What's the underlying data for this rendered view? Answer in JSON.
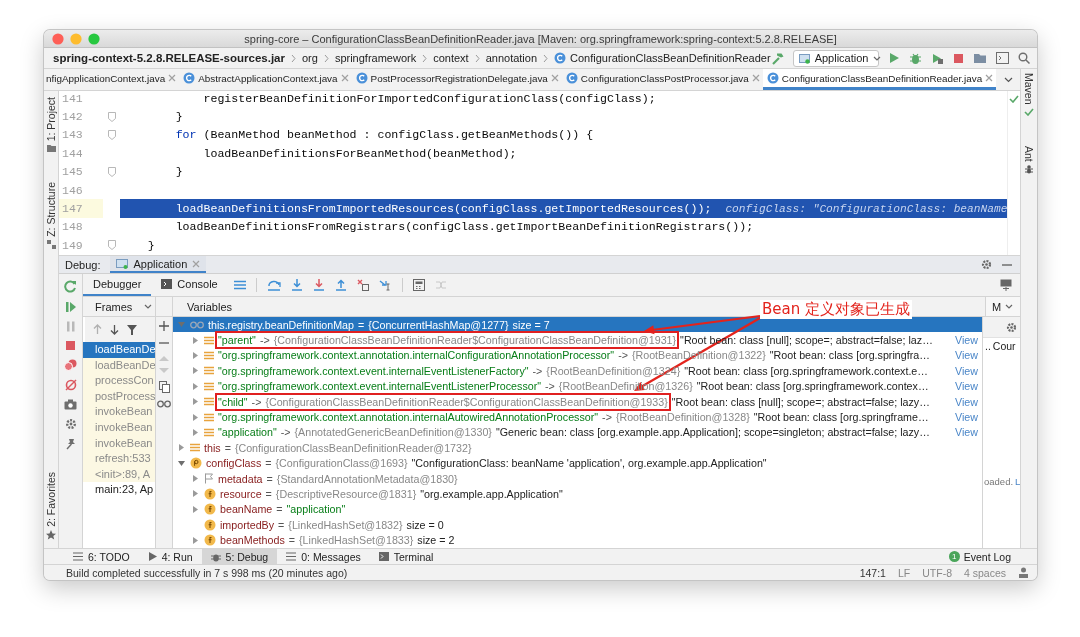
{
  "window": {
    "title": "spring-core – ConfigurationClassBeanDefinitionReader.java [Maven: org.springframework:spring-context:5.2.8.RELEASE]"
  },
  "breadcrumbs": [
    {
      "label": "spring-context-5.2.8.RELEASE-sources.jar",
      "kind": "jar"
    },
    {
      "label": "org",
      "kind": "package"
    },
    {
      "label": "springframework",
      "kind": "package"
    },
    {
      "label": "context",
      "kind": "package"
    },
    {
      "label": "annotation",
      "kind": "package"
    },
    {
      "label": "ConfigurationClassBeanDefinitionReader",
      "kind": "class"
    }
  ],
  "run_config": {
    "label": "Application"
  },
  "left_strip": [
    {
      "label": "1: Project",
      "kind": "project"
    },
    {
      "label": "Z: Structure",
      "kind": "structure"
    },
    {
      "label": "2: Favorites",
      "kind": "favorites"
    }
  ],
  "right_strip": [
    {
      "label": "Maven",
      "kind": "maven"
    },
    {
      "label": "Ant",
      "kind": "ant"
    }
  ],
  "editor_tabs": [
    {
      "label": "nfigApplicationContext.java",
      "kind": "partial",
      "selected": false
    },
    {
      "label": "AbstractApplicationContext.java",
      "kind": "file",
      "selected": false
    },
    {
      "label": "PostProcessorRegistrationDelegate.java",
      "kind": "file",
      "selected": false
    },
    {
      "label": "ConfigurationClassPostProcessor.java",
      "kind": "file",
      "selected": false
    },
    {
      "label": "ConfigurationClassBeanDefinitionReader.java",
      "kind": "file",
      "selected": true
    }
  ],
  "code_lines": [
    {
      "number": "141",
      "fold_marker": false,
      "current": false,
      "segments": [
        {
          "kind": "plain",
          "text": "            registerBeanDefinitionForImportedConfigurationClass(configClass);"
        }
      ]
    },
    {
      "number": "142",
      "fold_marker": true,
      "current": false,
      "segments": [
        {
          "kind": "plain",
          "text": "        }"
        }
      ]
    },
    {
      "number": "143",
      "fold_marker": true,
      "current": false,
      "segments": [
        {
          "kind": "keyword",
          "text": "        for"
        },
        {
          "kind": "plain",
          "text": " (BeanMethod beanMethod : configClass.getBeanMethods()) {"
        }
      ]
    },
    {
      "number": "144",
      "fold_marker": false,
      "current": false,
      "segments": [
        {
          "kind": "plain",
          "text": "            loadBeanDefinitionsForBeanMethod(beanMethod);"
        }
      ]
    },
    {
      "number": "145",
      "fold_marker": true,
      "current": false,
      "segments": [
        {
          "kind": "plain",
          "text": "        }"
        }
      ]
    },
    {
      "number": "146",
      "fold_marker": false,
      "current": false
    },
    {
      "number": "147",
      "fold_marker": false,
      "current": true,
      "segments": [
        {
          "kind": "plain",
          "text": "        loadBeanDefinitionsFromImportedResources(configClass.getImportedResources());"
        }
      ],
      "hint": "configClass: \"ConfigurationClass: beanName"
    },
    {
      "number": "148",
      "fold_marker": false,
      "current": false,
      "segments": [
        {
          "kind": "plain",
          "text": "        loadBeanDefinitionsFromRegistrars(configClass.getImportBeanDefinitionRegistrars());"
        }
      ]
    },
    {
      "number": "149",
      "fold_marker": true,
      "current": false,
      "segments": [
        {
          "kind": "plain",
          "text": "    }"
        }
      ]
    }
  ],
  "debug": {
    "label": "Debug:",
    "session_tabs": [
      {
        "label": "Application",
        "selected": true
      }
    ],
    "view_tabs": [
      {
        "label": "Debugger",
        "kind": "debugger",
        "selected": true
      },
      {
        "label": "Console",
        "kind": "console",
        "selected": false
      }
    ],
    "frames_header": "Frames",
    "variables_header": "Variables"
  },
  "frames": [
    {
      "label": "loadBeanDe",
      "selected": true,
      "library": false
    },
    {
      "label": "loadBeanDe",
      "selected": false,
      "library": true
    },
    {
      "label": "processCon",
      "selected": false,
      "library": true
    },
    {
      "label": "postProcess",
      "selected": false,
      "library": true
    },
    {
      "label": "invokeBean",
      "selected": false,
      "library": true
    },
    {
      "label": "invokeBean",
      "selected": false,
      "library": true
    },
    {
      "label": "invokeBean",
      "selected": false,
      "library": true
    },
    {
      "label": "refresh:533",
      "selected": false,
      "library": true
    },
    {
      "label": "<init>:89, A",
      "selected": false,
      "library": true
    },
    {
      "label": "main:23, Ap",
      "selected": false,
      "library": false
    }
  ],
  "variables": [
    {
      "kind": "watch",
      "name": "this.registry.beanDefinitionMap",
      "separator": "=",
      "value": "{ConcurrentHashMap@1277}",
      "description": "size = 7",
      "expanded": true,
      "selected": true,
      "boxed": false,
      "children": [
        {
          "kind": "entry",
          "name": "\"parent\"",
          "separator": "->",
          "value": "{ConfigurationClassBeanDefinitionReader$ConfigurationClassBeanDefinition@1931}",
          "description": "\"Root bean: class [null]; scope=; abstract=false; laz…",
          "link": "View",
          "expanded": false,
          "selected": false,
          "boxed": true
        },
        {
          "kind": "entry",
          "name": "\"org.springframework.context.annotation.internalConfigurationAnnotationProcessor\"",
          "separator": "->",
          "value": "{RootBeanDefinition@1322}",
          "description": "\"Root bean: class [org.springfra…",
          "link": "View",
          "expanded": false,
          "selected": false,
          "boxed": false
        },
        {
          "kind": "entry",
          "name": "\"org.springframework.context.event.internalEventListenerFactory\"",
          "separator": "->",
          "value": "{RootBeanDefinition@1324}",
          "description": "\"Root bean: class [org.springframework.context.e…",
          "link": "View",
          "expanded": false,
          "selected": false,
          "boxed": false
        },
        {
          "kind": "entry",
          "name": "\"org.springframework.context.event.internalEventListenerProcessor\"",
          "separator": "->",
          "value": "{RootBeanDefinition@1326}",
          "description": "\"Root bean: class [org.springframework.contex…",
          "link": "View",
          "expanded": false,
          "selected": false,
          "boxed": false
        },
        {
          "kind": "entry",
          "name": "\"child\"",
          "separator": "->",
          "value": "{ConfigurationClassBeanDefinitionReader$ConfigurationClassBeanDefinition@1933}",
          "description": "\"Root bean: class [null]; scope=; abstract=false; lazy…",
          "link": "View",
          "expanded": false,
          "selected": false,
          "boxed": true
        },
        {
          "kind": "entry",
          "name": "\"org.springframework.context.annotation.internalAutowiredAnnotationProcessor\"",
          "separator": "->",
          "value": "{RootBeanDefinition@1328}",
          "description": "\"Root bean: class [org.springframe…",
          "link": "View",
          "expanded": false,
          "selected": false,
          "boxed": false
        },
        {
          "kind": "entry",
          "name": "\"application\"",
          "separator": "->",
          "value": "{AnnotatedGenericBeanDefinition@1330}",
          "description": "\"Generic bean: class [org.example.app.Application]; scope=singleton; abstract=false; lazy…",
          "link": "View",
          "expanded": false,
          "selected": false,
          "boxed": false
        }
      ]
    },
    {
      "kind": "local",
      "name": "this",
      "separator": "=",
      "value": "{ConfigurationClassBeanDefinitionReader@1732}",
      "expanded": false,
      "selected": false,
      "boxed": false
    },
    {
      "kind": "param",
      "name": "configClass",
      "separator": "=",
      "value": "{ConfigurationClass@1693}",
      "description": "\"ConfigurationClass: beanName 'application', org.example.app.Application\"",
      "expanded": true,
      "selected": false,
      "boxed": false,
      "children": [
        {
          "kind": "annotation",
          "name": "metadata",
          "separator": "=",
          "value": "{StandardAnnotationMetadata@1830}",
          "expanded": false,
          "selected": false,
          "boxed": false
        },
        {
          "kind": "field",
          "name": "resource",
          "separator": "=",
          "value": "{DescriptiveResource@1831}",
          "description": "\"org.example.app.Application\"",
          "expanded": false,
          "selected": false,
          "boxed": false
        },
        {
          "kind": "string_field",
          "name": "beanName",
          "separator": "=",
          "value": "\"application\"",
          "expanded": false,
          "selected": false,
          "boxed": false
        },
        {
          "kind": "field",
          "name": "importedBy",
          "separator": "=",
          "value": "{LinkedHashSet@1832}",
          "description": "size = 0",
          "selected": false,
          "boxed": false
        },
        {
          "kind": "field",
          "name": "beanMethods",
          "separator": "=",
          "value": "{LinkedHashSet@1833}",
          "description": "size = 2",
          "expanded": false,
          "selected": false,
          "boxed": false
        }
      ]
    }
  ],
  "right_panel": {
    "header": "M",
    "cells": [
      "..",
      "Cour"
    ],
    "message": "oaded.",
    "link": "L"
  },
  "annotation": {
    "text": "Bean 定义对象已生成"
  },
  "tool_tabs": [
    {
      "label": "6: TODO",
      "kind": "todo",
      "selected": false
    },
    {
      "label": "4: Run",
      "kind": "run",
      "selected": false
    },
    {
      "label": "5: Debug",
      "kind": "debug",
      "selected": true
    },
    {
      "label": "0: Messages",
      "kind": "messages",
      "selected": false
    },
    {
      "label": "Terminal",
      "kind": "terminal",
      "selected": false
    }
  ],
  "event_log": {
    "label": "Event Log",
    "badge": "1"
  },
  "status_bar": {
    "message": "Build completed successfully in 7 s 998 ms (20 minutes ago)",
    "items": [
      "147:1",
      "LF",
      "UTF-8",
      "4 spaces"
    ]
  }
}
